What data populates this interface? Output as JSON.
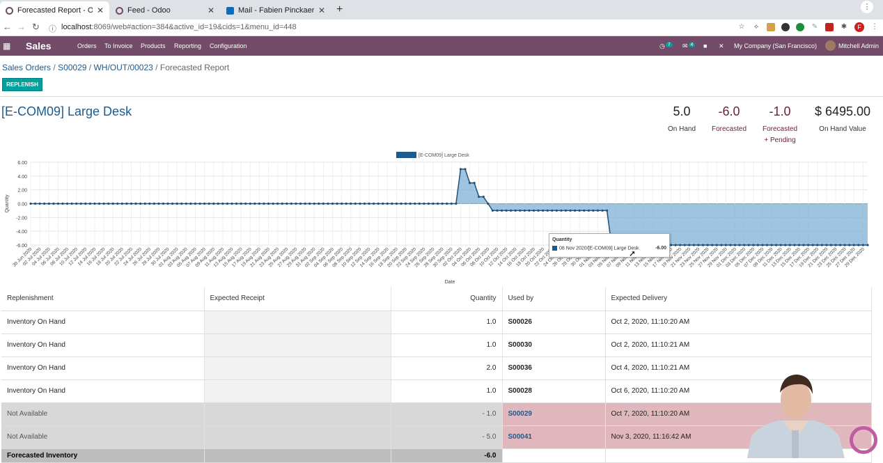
{
  "browser": {
    "tabs": [
      {
        "label": "Forecasted Report - Odoo",
        "icon": "odoo-icon",
        "active": true
      },
      {
        "label": "Feed - Odoo",
        "icon": "odoo-icon",
        "active": false
      },
      {
        "label": "Mail - Fabien Pinckaers - Outlook",
        "icon": "outlook-icon",
        "active": false
      }
    ],
    "new_tab": "+",
    "url_host": "localhost",
    "url_path": ":8069/web#action=384&active_id=19&cids=1&menu_id=448",
    "profile_initial": "F"
  },
  "navbar": {
    "app": "Sales",
    "menu": [
      "Orders",
      "To Invoice",
      "Products",
      "Reporting",
      "Configuration"
    ],
    "activity_count": "7",
    "message_count": "4",
    "company": "My Company (San Francisco)",
    "user": "Mitchell Admin"
  },
  "breadcrumb": {
    "items": [
      "Sales Orders",
      "S00029",
      "WH/OUT/00023"
    ],
    "separator": "/",
    "current": "Forecasted Report"
  },
  "buttons": {
    "replenish": "REPLENISH"
  },
  "product": {
    "title": "[E-COM09] Large Desk"
  },
  "stats": [
    {
      "value": "5.0",
      "label": "On Hand",
      "label2": ""
    },
    {
      "value": "-6.0",
      "label": "Forecasted",
      "label2": ""
    },
    {
      "value": "-1.0",
      "label": "Forecasted",
      "label2": "+ Pending"
    },
    {
      "value": "$ 6495.00",
      "label": "On Hand Value",
      "label2": ""
    }
  ],
  "chart_data": {
    "type": "area",
    "title": "",
    "xlabel": "Date",
    "ylabel": "Quantity",
    "ylim": [
      -6,
      6
    ],
    "yticks": [
      "6.00",
      "4.00",
      "2.00",
      "0.00",
      "-2.00",
      "-4.00",
      "-6.00"
    ],
    "legend": "top",
    "grid": true,
    "series": [
      {
        "name": "[E-COM09] Large Desk",
        "color": "#1f5a8c"
      }
    ],
    "x_start": "30 Jun 2020",
    "x_end": "29 Dec 2020",
    "xtick_labels": [
      "30 Jun 2020",
      "02 Jul 2020",
      "04 Jul 2020",
      "06 Jul 2020",
      "08 Jul 2020",
      "10 Jul 2020",
      "12 Jul 2020",
      "14 Jul 2020",
      "16 Jul 2020",
      "18 Jul 2020",
      "20 Jul 2020",
      "22 Jul 2020",
      "24 Jul 2020",
      "26 Jul 2020",
      "28 Jul 2020",
      "30 Jul 2020",
      "01 Aug 2020",
      "03 Aug 2020",
      "05 Aug 2020",
      "07 Aug 2020",
      "09 Aug 2020",
      "11 Aug 2020",
      "13 Aug 2020",
      "15 Aug 2020",
      "17 Aug 2020",
      "19 Aug 2020",
      "21 Aug 2020",
      "23 Aug 2020",
      "25 Aug 2020",
      "27 Aug 2020",
      "29 Aug 2020",
      "31 Aug 2020",
      "02 Sep 2020",
      "04 Sep 2020",
      "06 Sep 2020",
      "08 Sep 2020",
      "10 Sep 2020",
      "12 Sep 2020",
      "14 Sep 2020",
      "16 Sep 2020",
      "18 Sep 2020",
      "20 Sep 2020",
      "22 Sep 2020",
      "24 Sep 2020",
      "26 Sep 2020",
      "28 Sep 2020",
      "30 Sep 2020",
      "02 Oct 2020",
      "04 Oct 2020",
      "06 Oct 2020",
      "08 Oct 2020",
      "10 Oct 2020",
      "12 Oct 2020",
      "14 Oct 2020",
      "16 Oct 2020",
      "18 Oct 2020",
      "20 Oct 2020",
      "22 Oct 2020",
      "24 Oct 2020",
      "26 Oct 2020",
      "28 Oct 2020",
      "30 Oct 2020",
      "01 Nov 2020",
      "03 Nov 2020",
      "05 Nov 2020",
      "07 Nov 2020",
      "09 Nov 2020",
      "11 Nov 2020",
      "13 Nov 2020",
      "15 Nov 2020",
      "17 Nov 2020",
      "19 Nov 2020",
      "21 Nov 2020",
      "23 Nov 2020",
      "25 Nov 2020",
      "27 Nov 2020",
      "29 Nov 2020",
      "01 Dec 2020",
      "03 Dec 2020",
      "05 Dec 2020",
      "07 Dec 2020",
      "09 Dec 2020",
      "11 Dec 2020",
      "13 Dec 2020",
      "15 Dec 2020",
      "17 Dec 2020",
      "19 Dec 2020",
      "21 Dec 2020",
      "23 Dec 2020",
      "25 Dec 2020",
      "27 Dec 2020",
      "29 Dec 2020"
    ],
    "points": [
      {
        "x": "2020-06-30",
        "y": 0
      },
      {
        "x": "2020-10-01",
        "y": 0
      },
      {
        "x": "2020-10-02",
        "y": 5
      },
      {
        "x": "2020-10-03",
        "y": 5
      },
      {
        "x": "2020-10-04",
        "y": 3
      },
      {
        "x": "2020-10-05",
        "y": 3
      },
      {
        "x": "2020-10-06",
        "y": 1
      },
      {
        "x": "2020-10-07",
        "y": 1
      },
      {
        "x": "2020-10-08",
        "y": 0
      },
      {
        "x": "2020-10-09",
        "y": -1
      },
      {
        "x": "2020-11-03",
        "y": -1
      },
      {
        "x": "2020-11-04",
        "y": -6
      },
      {
        "x": "2020-12-30",
        "y": -6
      }
    ],
    "tooltip": {
      "title": "Quantity",
      "label": "08 Nov 2020/[E-COM09] Large Desk",
      "value": "-6.00"
    }
  },
  "table": {
    "headers": [
      "Replenishment",
      "Expected Receipt",
      "Quantity",
      "Used by",
      "Expected Delivery"
    ],
    "rows": [
      {
        "replenishment": "Inventory On Hand",
        "receipt": "",
        "quantity": "1.0",
        "used_by": "S00026",
        "delivery": "Oct 2, 2020, 11:10:20 AM",
        "status": "onhand"
      },
      {
        "replenishment": "Inventory On Hand",
        "receipt": "",
        "quantity": "1.0",
        "used_by": "S00030",
        "delivery": "Oct 2, 2020, 11:10:21 AM",
        "status": "onhand"
      },
      {
        "replenishment": "Inventory On Hand",
        "receipt": "",
        "quantity": "2.0",
        "used_by": "S00036",
        "delivery": "Oct 4, 2020, 11:10:21 AM",
        "status": "onhand"
      },
      {
        "replenishment": "Inventory On Hand",
        "receipt": "",
        "quantity": "1.0",
        "used_by": "S00028",
        "delivery": "Oct 6, 2020, 11:10:20 AM",
        "status": "onhand"
      },
      {
        "replenishment": "Not Available",
        "receipt": "",
        "quantity": "- 1.0",
        "used_by": "S00029",
        "delivery": "Oct 7, 2020, 11:10:20 AM",
        "status": "na"
      },
      {
        "replenishment": "Not Available",
        "receipt": "",
        "quantity": "- 5.0",
        "used_by": "S00041",
        "delivery": "Nov 3, 2020, 11:16:42 AM",
        "status": "na"
      }
    ],
    "footer": {
      "label": "Forecasted Inventory",
      "quantity": "-6.0"
    }
  },
  "colors": {
    "odoo_purple": "#714b67",
    "link_blue": "#1f5a8c",
    "teal": "#00a09d",
    "negative_red": "#6b1f2f",
    "unavailable_row": "#dfb7bd"
  }
}
